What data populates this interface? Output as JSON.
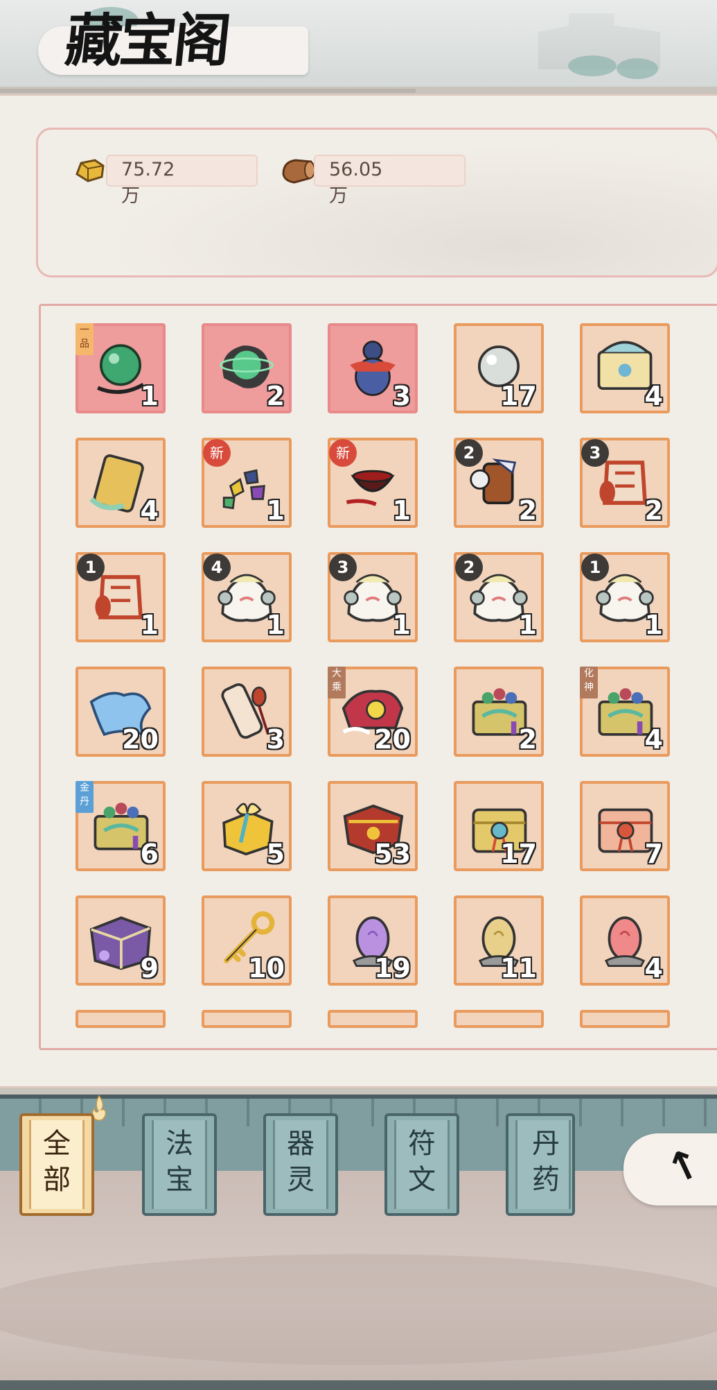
{
  "header": {
    "title": "藏宝阁"
  },
  "resources": [
    {
      "name": "gold-ingot-icon",
      "value": "75.72万"
    },
    {
      "name": "wood-log-icon",
      "value": "56.05万"
    }
  ],
  "items": [
    {
      "icon": "jade-orb-icon",
      "count": "1",
      "bg": "red",
      "tag": "一品"
    },
    {
      "icon": "spirit-orb-icon",
      "count": "2",
      "bg": "red"
    },
    {
      "icon": "gourd-icon",
      "count": "3",
      "bg": "red"
    },
    {
      "icon": "pearl-icon",
      "count": "17"
    },
    {
      "icon": "spirit-chest-icon",
      "count": "4"
    },
    {
      "icon": "talisman-token-icon",
      "count": "4"
    },
    {
      "icon": "gemstones-icon",
      "count": "1",
      "badge": "新"
    },
    {
      "icon": "blood-bowl-icon",
      "count": "1",
      "badge": "新"
    },
    {
      "icon": "armor-gauntlet-icon",
      "count": "2",
      "level": "2"
    },
    {
      "icon": "armor-vest-icon",
      "count": "2",
      "level": "3"
    },
    {
      "icon": "armor-vest-icon",
      "count": "1",
      "level": "1"
    },
    {
      "icon": "beast-spirit-icon",
      "count": "1",
      "level": "4"
    },
    {
      "icon": "beast-spirit-icon",
      "count": "1",
      "level": "3"
    },
    {
      "icon": "beast-spirit-icon",
      "count": "1",
      "level": "2"
    },
    {
      "icon": "beast-spirit-icon",
      "count": "1",
      "level": "1"
    },
    {
      "icon": "silk-cloth-icon",
      "count": "20"
    },
    {
      "icon": "scroll-icon",
      "count": "3"
    },
    {
      "icon": "ornate-treasure-icon",
      "count": "20",
      "tag": "大乘",
      "tagColor": "brown"
    },
    {
      "icon": "jeweled-chest-icon",
      "count": "2"
    },
    {
      "icon": "jeweled-chest-icon",
      "count": "4",
      "tag": "化神",
      "tagColor": "brown"
    },
    {
      "icon": "jeweled-chest-icon",
      "count": "6",
      "tag": "金丹",
      "tagColor": "blue"
    },
    {
      "icon": "gift-box-icon",
      "count": "5"
    },
    {
      "icon": "red-chest-icon",
      "count": "53"
    },
    {
      "icon": "gold-chest-icon",
      "count": "17"
    },
    {
      "icon": "rose-chest-icon",
      "count": "7"
    },
    {
      "icon": "purple-chest-icon",
      "count": "9"
    },
    {
      "icon": "golden-key-icon",
      "count": "10"
    },
    {
      "icon": "purple-egg-icon",
      "count": "19"
    },
    {
      "icon": "gold-egg-icon",
      "count": "11"
    },
    {
      "icon": "red-egg-icon",
      "count": "4"
    }
  ],
  "tabs": [
    {
      "label1": "全",
      "label2": "部",
      "active": true
    },
    {
      "label1": "法",
      "label2": "宝"
    },
    {
      "label1": "器",
      "label2": "灵"
    },
    {
      "label1": "符",
      "label2": "文"
    },
    {
      "label1": "丹",
      "label2": "药"
    }
  ],
  "colors": {
    "cell_bg": "#f2d4bd",
    "cell_border": "#e99a5d",
    "cell_red": "#ee9c9c",
    "tab_active": "#f4d9a4",
    "tab": "#8fb0b1"
  }
}
